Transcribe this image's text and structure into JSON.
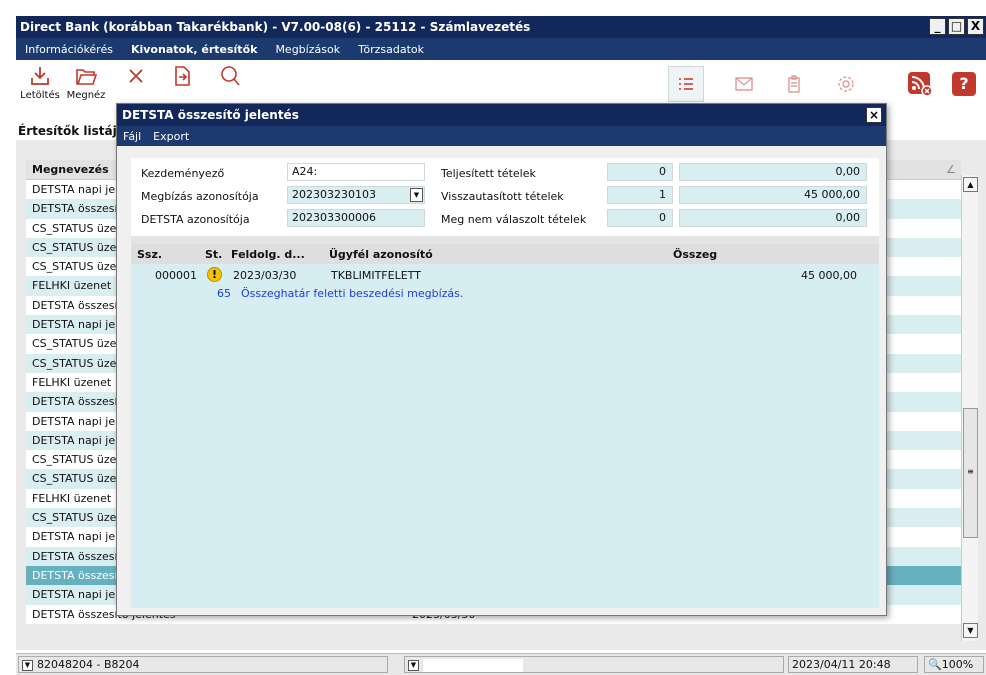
{
  "app": {
    "title": "Direct Bank (korábban Takarékbank) - V7.00-08(6) - 25112 - Számlavezetés",
    "window_buttons": [
      "_",
      "□",
      "X"
    ]
  },
  "menu": [
    {
      "label": "Információkérés",
      "bold": false
    },
    {
      "label": "Kivonatok, értesítők",
      "bold": true
    },
    {
      "label": "Megbízások",
      "bold": false
    },
    {
      "label": "Törzsadatok",
      "bold": false
    }
  ],
  "toolbar": {
    "download_label": "Letöltés",
    "open_label": "Megnéz",
    "delete_icon": "close-icon",
    "export_icon": "file-export-icon",
    "search_icon": "search-icon",
    "right_icons": [
      "list-icon",
      "mail-icon",
      "clipboard-icon",
      "settings-icon",
      "rss-off-icon",
      "help-icon"
    ],
    "help_label": "?"
  },
  "page_title": "Értesítők listája",
  "list": {
    "header": "Megnevezés",
    "rows": [
      {
        "name": "DETSTA napi jelentés",
        "date": ""
      },
      {
        "name": "DETSTA összesítő jelentés",
        "date": ""
      },
      {
        "name": "CS_STATUS üzenet",
        "date": ""
      },
      {
        "name": "CS_STATUS üzenet",
        "date": ""
      },
      {
        "name": "CS_STATUS üzenet",
        "date": ""
      },
      {
        "name": "FELHKI üzenet",
        "date": ""
      },
      {
        "name": "DETSTA összesítő jelentés",
        "date": ""
      },
      {
        "name": "DETSTA napi jelentés",
        "date": ""
      },
      {
        "name": "CS_STATUS üzenet",
        "date": ""
      },
      {
        "name": "CS_STATUS üzenet",
        "date": ""
      },
      {
        "name": "FELHKI üzenet",
        "date": ""
      },
      {
        "name": "DETSTA összesítő jelentés",
        "date": ""
      },
      {
        "name": "DETSTA napi jelentés",
        "date": ""
      },
      {
        "name": "DETSTA napi jelentés",
        "date": ""
      },
      {
        "name": "CS_STATUS üzenet",
        "date": ""
      },
      {
        "name": "CS_STATUS üzenet",
        "date": ""
      },
      {
        "name": "FELHKI üzenet",
        "date": ""
      },
      {
        "name": "CS_STATUS üzenet",
        "date": ""
      },
      {
        "name": "DETSTA napi jelentés",
        "date": ""
      },
      {
        "name": "DETSTA összesítő jelentés",
        "date": ""
      },
      {
        "name": "DETSTA összesítő jelentés",
        "date": "",
        "selected": true
      },
      {
        "name": "DETSTA napi jelentés",
        "date": ""
      },
      {
        "name": "DETSTA összesítő jelentés",
        "date": "2023/03/30"
      }
    ]
  },
  "status": {
    "account": "82048204 - B8204",
    "datetime": "2023/04/11 20:48",
    "zoom": "100%"
  },
  "dialog": {
    "title": "DETSTA összesítő jelentés",
    "menu": [
      "Fájl",
      "Export"
    ],
    "form": {
      "initiator_label": "Kezdeményező",
      "initiator_value": "A24:",
      "order_id_label": "Megbízás azonosítója",
      "order_id_value": "202303230103",
      "detsta_id_label": "DETSTA azonosítója",
      "detsta_id_value": "202303300006",
      "completed_label": "Teljesített tételek",
      "completed_count": "0",
      "completed_amount": "0,00",
      "rejected_label": "Visszautasított tételek",
      "rejected_count": "1",
      "rejected_amount": "45 000,00",
      "unanswered_label": "Meg nem válaszolt tételek",
      "unanswered_count": "0",
      "unanswered_amount": "0,00"
    },
    "grid": {
      "headers": {
        "seq": "Ssz.",
        "status": "St.",
        "date": "Feldolg. d...",
        "client": "Ügyfél azonosító",
        "amount": "Összeg"
      },
      "rows": [
        {
          "seq": "000001",
          "status_icon": "warning-icon",
          "status_glyph": "!",
          "date": "2023/03/30",
          "client": "TKBLIMITFELETT",
          "amount": "45 000,00",
          "code": "65",
          "message": "Összeghatár feletti beszedési megbízás."
        }
      ]
    }
  }
}
